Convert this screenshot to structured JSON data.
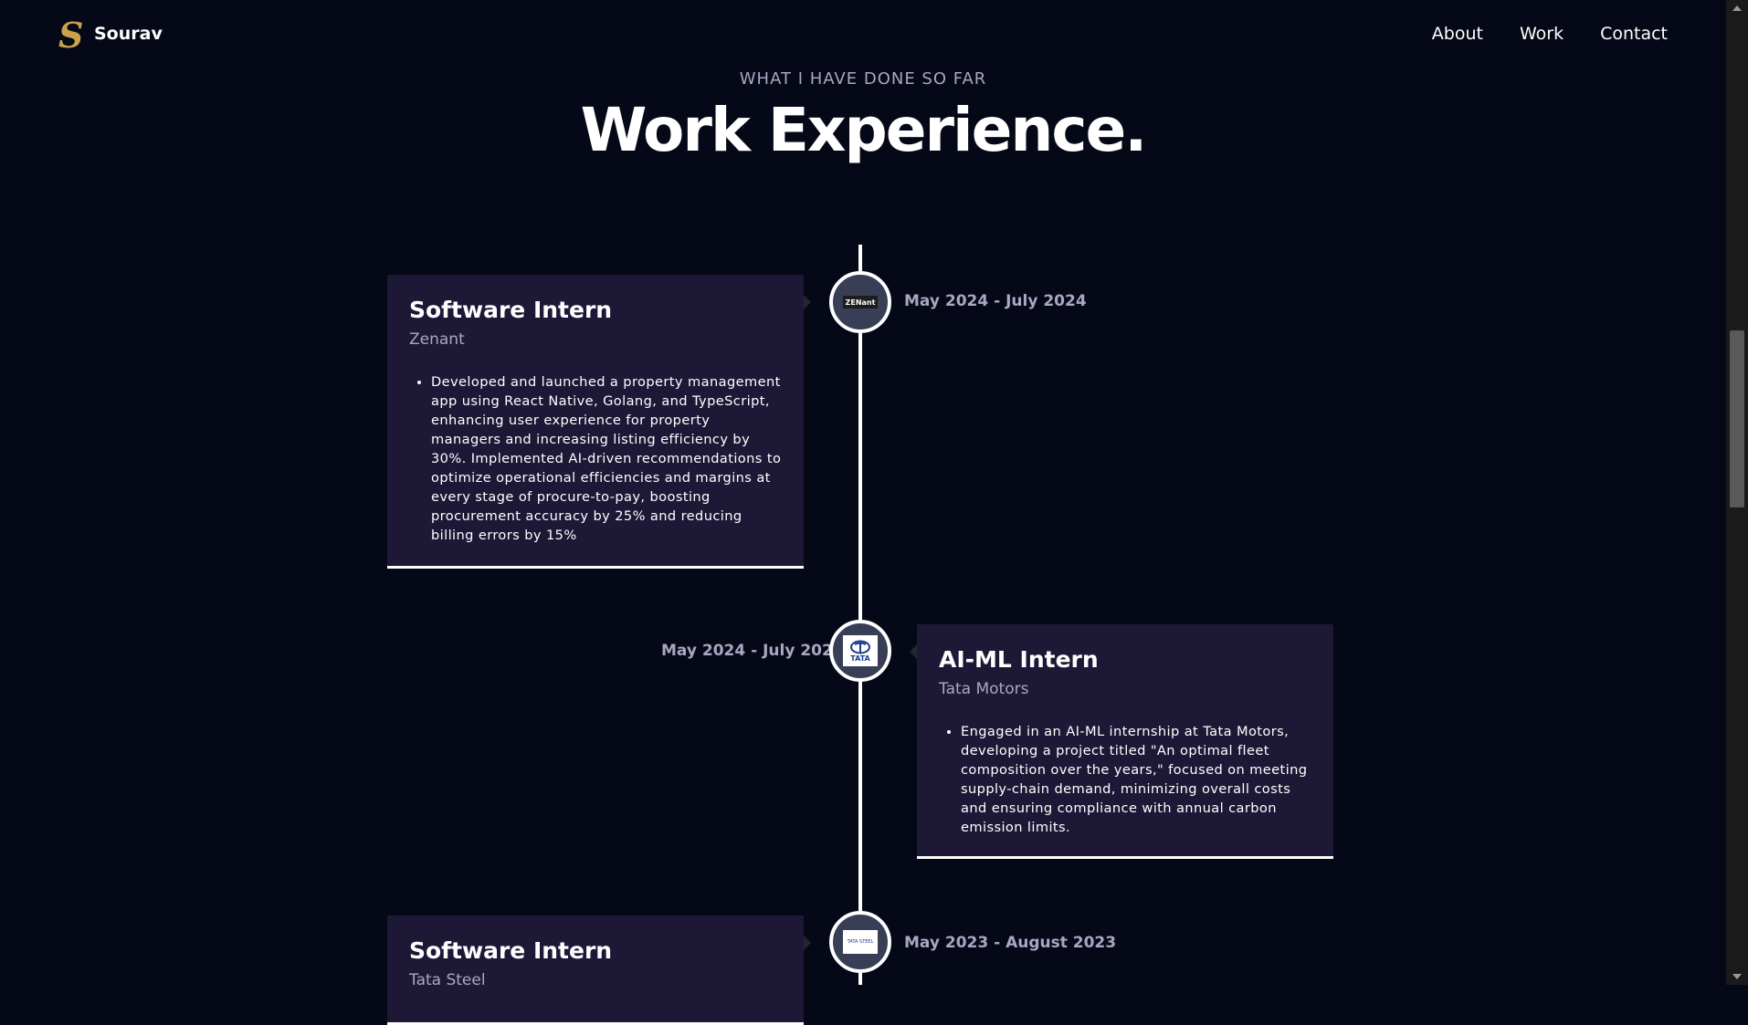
{
  "nav": {
    "brand": "Sourav",
    "logo_letter": "S",
    "links": [
      "About",
      "Work",
      "Contact"
    ]
  },
  "section": {
    "subtitle": "WHAT I HAVE DONE SO FAR",
    "title": "Work Experience."
  },
  "experiences": [
    {
      "title": "Software Intern",
      "company": "Zenant",
      "date": "May 2024 - July 2024",
      "icon": "zenant-logo-icon",
      "icon_text": "ZENant",
      "points": [
        "Developed and launched a property management app using React Native, Golang, and TypeScript, enhancing user experience for property managers and increasing listing efficiency by 30%. Implemented AI-driven recommendations to optimize operational efficiencies and margins at every stage of procure-to-pay, boosting procurement accuracy by 25% and reducing billing errors by 15%"
      ]
    },
    {
      "title": "AI-ML Intern",
      "company": "Tata Motors",
      "date": "May 2024 - July 2024",
      "icon": "tata-motors-logo-icon",
      "icon_text": "TATA",
      "points": [
        "Engaged in an AI-ML internship at Tata Motors, developing a project titled \"An optimal fleet composition over the years,\" focused on meeting supply-chain demand, minimizing overall costs and ensuring compliance with annual carbon emission limits."
      ]
    },
    {
      "title": "Software Intern",
      "company": "Tata Steel",
      "date": "May 2023 - August 2023",
      "icon": "tata-steel-logo-icon",
      "icon_text": "TATA STEEL",
      "points": []
    }
  ],
  "colors": {
    "background": "#050816",
    "card": "#1d1836",
    "secondary_text": "#aaa6c3",
    "icon_bg": "#383e56",
    "logo_gold": "#c9a24a"
  }
}
